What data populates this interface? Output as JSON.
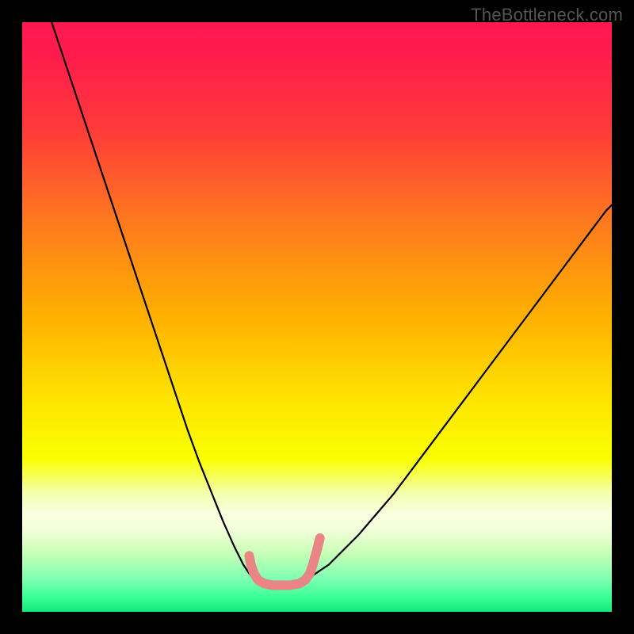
{
  "watermark": "TheBottleneck.com",
  "chart_data": {
    "type": "line",
    "title": "",
    "xlabel": "",
    "ylabel": "",
    "xlim": [
      0,
      100
    ],
    "ylim": [
      0,
      100
    ],
    "gradient_stops": [
      {
        "offset": 0.0,
        "color": "#ff1850"
      },
      {
        "offset": 0.06,
        "color": "#ff1c4d"
      },
      {
        "offset": 0.18,
        "color": "#ff3a3a"
      },
      {
        "offset": 0.34,
        "color": "#ff7a1e"
      },
      {
        "offset": 0.5,
        "color": "#ffb100"
      },
      {
        "offset": 0.64,
        "color": "#ffe400"
      },
      {
        "offset": 0.74,
        "color": "#f9ff00"
      },
      {
        "offset": 0.8,
        "color": "#f5ffb0"
      },
      {
        "offset": 0.835,
        "color": "#f9ffe0"
      },
      {
        "offset": 0.86,
        "color": "#f4ffda"
      },
      {
        "offset": 0.9,
        "color": "#c9ffb8"
      },
      {
        "offset": 0.945,
        "color": "#7cffb1"
      },
      {
        "offset": 0.975,
        "color": "#3bff95"
      },
      {
        "offset": 1.0,
        "color": "#12e87a"
      }
    ],
    "series": [
      {
        "name": "left-branch",
        "stroke": "#000000",
        "width": 2.2,
        "x": [
          5,
          6,
          8,
          10,
          12,
          14,
          16,
          18,
          20,
          22,
          24,
          26,
          28,
          30,
          32,
          34,
          36,
          37.5,
          38.5,
          39,
          39.5
        ],
        "y": [
          100,
          97,
          91,
          85,
          79,
          73,
          67,
          61,
          55,
          49,
          43,
          37,
          31,
          25.5,
          20.5,
          15.5,
          11,
          8,
          6.5,
          5.8,
          5.3
        ]
      },
      {
        "name": "right-branch",
        "stroke": "#000000",
        "width": 2.2,
        "x": [
          48.5,
          49,
          49.5,
          50.5,
          52,
          54,
          57,
          60,
          63,
          66,
          69,
          72,
          75,
          78,
          81,
          84,
          87,
          90,
          93,
          96,
          99,
          100
        ],
        "y": [
          5.3,
          5.8,
          6.3,
          7,
          8,
          10,
          13,
          16.5,
          20,
          24,
          28,
          32,
          36,
          40,
          44,
          48,
          52,
          56,
          60,
          64,
          68,
          69
        ]
      },
      {
        "name": "trough-marker",
        "stroke": "#e98585",
        "width": 12,
        "x": [
          38.5,
          38.8,
          39.3,
          40,
          41,
          42.5,
          44,
          45.5,
          47,
          48,
          48.8,
          49.3,
          50,
          50.5
        ],
        "y": [
          9.5,
          8,
          6.5,
          5.4,
          4.8,
          4.5,
          4.5,
          4.5,
          4.8,
          5.4,
          6.5,
          8,
          10.5,
          12.5
        ]
      }
    ]
  }
}
